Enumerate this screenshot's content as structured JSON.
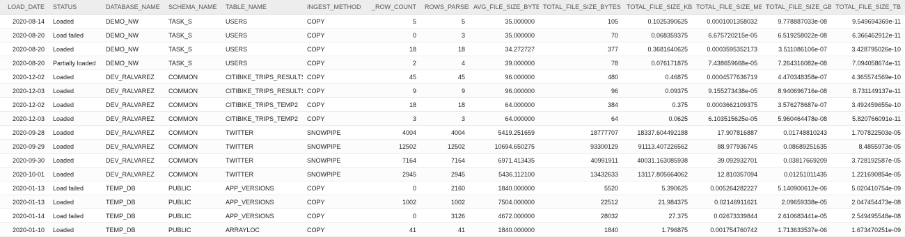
{
  "columns": [
    {
      "label": "LOAD_DATE",
      "numeric": true
    },
    {
      "label": "STATUS",
      "numeric": false
    },
    {
      "label": "DATABASE_NAME",
      "numeric": false
    },
    {
      "label": "SCHEMA_NAME",
      "numeric": false
    },
    {
      "label": "TABLE_NAME",
      "numeric": false
    },
    {
      "label": "INGEST_METHOD",
      "numeric": false
    },
    {
      "label": "_ROW_COUNT",
      "numeric": true
    },
    {
      "label": "ROWS_PARSED",
      "numeric": true
    },
    {
      "label": "AVG_FILE_SIZE_BYTES",
      "numeric": true
    },
    {
      "label": "TOTAL_FILE_SIZE_BYTES",
      "numeric": true
    },
    {
      "label": "TOTAL_FILE_SIZE_KB",
      "numeric": true
    },
    {
      "label": "TOTAL_FILE_SIZE_MB",
      "numeric": true
    },
    {
      "label": "TOTAL_FILE_SIZE_GB",
      "numeric": true
    },
    {
      "label": "TOTAL_FILE_SIZE_TB",
      "numeric": true
    }
  ],
  "rows": [
    [
      "2020-08-14",
      "Loaded",
      "DEMO_NW",
      "TASK_S",
      "USERS",
      "COPY",
      "5",
      "5",
      "35.000000",
      "105",
      "0.1025390625",
      "0.0001001358032",
      "9.778887033e-08",
      "9.549694369e-11"
    ],
    [
      "2020-08-20",
      "Load failed",
      "DEMO_NW",
      "TASK_S",
      "USERS",
      "COPY",
      "0",
      "3",
      "35.000000",
      "70",
      "0.068359375",
      "6.675720215e-05",
      "6.519258022e-08",
      "6.366462912e-11"
    ],
    [
      "2020-08-20",
      "Loaded",
      "DEMO_NW",
      "TASK_S",
      "USERS",
      "COPY",
      "18",
      "18",
      "34.272727",
      "377",
      "0.3681640625",
      "0.0003595352173",
      "3.511086106e-07",
      "3.428795026e-10"
    ],
    [
      "2020-08-20",
      "Partially loaded",
      "DEMO_NW",
      "TASK_S",
      "USERS",
      "COPY",
      "2",
      "4",
      "39.000000",
      "78",
      "0.076171875",
      "7.438659668e-05",
      "7.264316082e-08",
      "7.094058674e-11"
    ],
    [
      "2020-12-02",
      "Loaded",
      "DEV_RALVAREZ",
      "COMMON",
      "CITIBIKE_TRIPS_RESULTS",
      "COPY",
      "45",
      "45",
      "96.000000",
      "480",
      "0.46875",
      "0.0004577636719",
      "4.470348358e-07",
      "4.365574569e-10"
    ],
    [
      "2020-12-03",
      "Loaded",
      "DEV_RALVAREZ",
      "COMMON",
      "CITIBIKE_TRIPS_RESULTS",
      "COPY",
      "9",
      "9",
      "96.000000",
      "96",
      "0.09375",
      "9.155273438e-05",
      "8.940696716e-08",
      "8.731149137e-11"
    ],
    [
      "2020-12-02",
      "Loaded",
      "DEV_RALVAREZ",
      "COMMON",
      "CITIBIKE_TRIPS_TEMP2",
      "COPY",
      "18",
      "18",
      "64.000000",
      "384",
      "0.375",
      "0.0003662109375",
      "3.576278687e-07",
      "3.492459655e-10"
    ],
    [
      "2020-12-03",
      "Loaded",
      "DEV_RALVAREZ",
      "COMMON",
      "CITIBIKE_TRIPS_TEMP2",
      "COPY",
      "3",
      "3",
      "64.000000",
      "64",
      "0.0625",
      "6.103515625e-05",
      "5.960464478e-08",
      "5.820766091e-11"
    ],
    [
      "2020-09-28",
      "Loaded",
      "DEV_RALVAREZ",
      "COMMON",
      "TWITTER",
      "SNOWPIPE",
      "4004",
      "4004",
      "5419.251659",
      "18777707",
      "18337.604492188",
      "17.907816887",
      "0.01748810243",
      "1.707822503e-05"
    ],
    [
      "2020-09-29",
      "Loaded",
      "DEV_RALVAREZ",
      "COMMON",
      "TWITTER",
      "SNOWPIPE",
      "12502",
      "12502",
      "10694.650275",
      "93300129",
      "91113.407226562",
      "88.977936745",
      "0.08689251635",
      "8.4855973e-05"
    ],
    [
      "2020-09-30",
      "Loaded",
      "DEV_RALVAREZ",
      "COMMON",
      "TWITTER",
      "SNOWPIPE",
      "7164",
      "7164",
      "6971.413435",
      "40991911",
      "40031.163085938",
      "39.092932701",
      "0.03817669209",
      "3.728192587e-05"
    ],
    [
      "2020-10-01",
      "Loaded",
      "DEV_RALVAREZ",
      "COMMON",
      "TWITTER",
      "SNOWPIPE",
      "2945",
      "2945",
      "5436.112100",
      "13432633",
      "13117.805664062",
      "12.810357094",
      "0.01251011435",
      "1.221690854e-05"
    ],
    [
      "2020-01-13",
      "Load failed",
      "TEMP_DB",
      "PUBLIC",
      "APP_VERSIONS",
      "COPY",
      "0",
      "2160",
      "1840.000000",
      "5520",
      "5.390625",
      "0.005264282227",
      "5.140900612e-06",
      "5.020410754e-09"
    ],
    [
      "2020-01-13",
      "Loaded",
      "TEMP_DB",
      "PUBLIC",
      "APP_VERSIONS",
      "COPY",
      "1002",
      "1002",
      "7504.000000",
      "22512",
      "21.984375",
      "0.02146911621",
      "2.09659338e-05",
      "2.047454473e-08"
    ],
    [
      "2020-01-14",
      "Load failed",
      "TEMP_DB",
      "PUBLIC",
      "APP_VERSIONS",
      "COPY",
      "0",
      "3126",
      "4672.000000",
      "28032",
      "27.375",
      "0.02673339844",
      "2.610683441e-05",
      "2.549495548e-08"
    ],
    [
      "2020-01-10",
      "Loaded",
      "TEMP_DB",
      "PUBLIC",
      "ARRAYLOC",
      "COPY",
      "41",
      "41",
      "1840.000000",
      "1840",
      "1.796875",
      "0.001754760742",
      "1.713633537e-06",
      "1.673470251e-09"
    ]
  ]
}
